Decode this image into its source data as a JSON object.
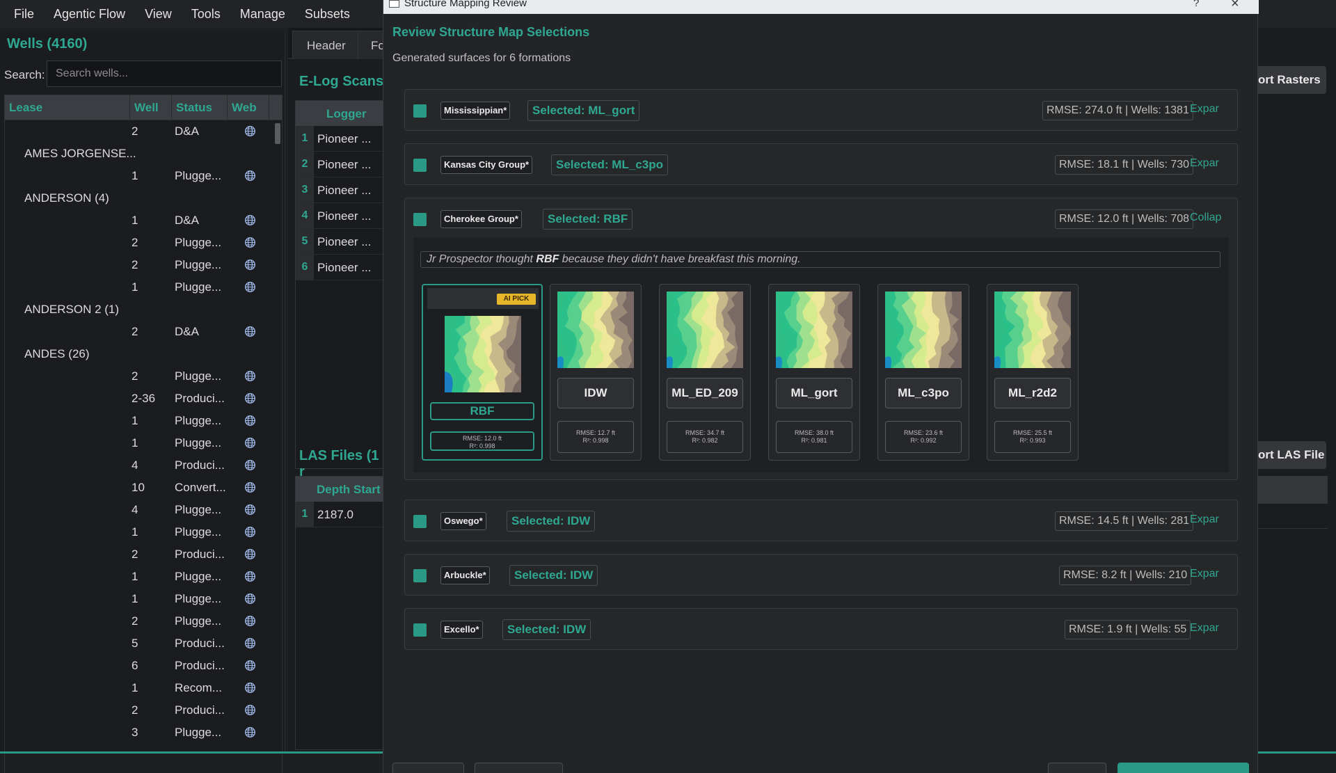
{
  "menu": [
    "File",
    "Agentic Flow",
    "View",
    "Tools",
    "Manage",
    "Subsets"
  ],
  "wells": {
    "title": "Wells (4160)",
    "search_label": "Search:",
    "search_placeholder": "Search wells...",
    "columns": [
      "Lease",
      "Well",
      "Status",
      "Web"
    ],
    "rows": [
      {
        "lease": "",
        "well": "2",
        "status": "D&A",
        "web": true
      },
      {
        "lease": "AMES JORGENSE...",
        "well": "",
        "status": "",
        "web": false
      },
      {
        "lease": "",
        "well": "1",
        "status": "Plugge...",
        "web": true
      },
      {
        "lease": "ANDERSON (4)",
        "well": "",
        "status": "",
        "web": false
      },
      {
        "lease": "",
        "well": "1",
        "status": "D&A",
        "web": true
      },
      {
        "lease": "",
        "well": "2",
        "status": "Plugge...",
        "web": true
      },
      {
        "lease": "",
        "well": "2",
        "status": "Plugge...",
        "web": true
      },
      {
        "lease": "",
        "well": "1",
        "status": "Plugge...",
        "web": true
      },
      {
        "lease": "ANDERSON 2 (1)",
        "well": "",
        "status": "",
        "web": false
      },
      {
        "lease": "",
        "well": "2",
        "status": "D&A",
        "web": true
      },
      {
        "lease": "ANDES (26)",
        "well": "",
        "status": "",
        "web": false
      },
      {
        "lease": "",
        "well": "2",
        "status": "Plugge...",
        "web": true
      },
      {
        "lease": "",
        "well": "2-36",
        "status": "Produci...",
        "web": true
      },
      {
        "lease": "",
        "well": "1",
        "status": "Plugge...",
        "web": true
      },
      {
        "lease": "",
        "well": "1",
        "status": "Plugge...",
        "web": true
      },
      {
        "lease": "",
        "well": "4",
        "status": "Produci...",
        "web": true
      },
      {
        "lease": "",
        "well": "10",
        "status": "Convert...",
        "web": true
      },
      {
        "lease": "",
        "well": "4",
        "status": "Plugge...",
        "web": true
      },
      {
        "lease": "",
        "well": "1",
        "status": "Plugge...",
        "web": true
      },
      {
        "lease": "",
        "well": "2",
        "status": "Produci...",
        "web": true
      },
      {
        "lease": "",
        "well": "1",
        "status": "Plugge...",
        "web": true
      },
      {
        "lease": "",
        "well": "1",
        "status": "Plugge...",
        "web": true
      },
      {
        "lease": "",
        "well": "2",
        "status": "Plugge...",
        "web": true
      },
      {
        "lease": "",
        "well": "5",
        "status": "Produci...",
        "web": true
      },
      {
        "lease": "",
        "well": "6",
        "status": "Produci...",
        "web": true
      },
      {
        "lease": "",
        "well": "1",
        "status": "Recom...",
        "web": true
      },
      {
        "lease": "",
        "well": "2",
        "status": "Produci...",
        "web": true
      },
      {
        "lease": "",
        "well": "3",
        "status": "Plugge...",
        "web": true
      }
    ]
  },
  "mid": {
    "tabs": [
      "Header",
      "Fo"
    ],
    "elog_title": "E-Log Scans",
    "elog_col": "Logger",
    "elog_rows": [
      "Pioneer ...",
      "Pioneer ...",
      "Pioneer ...",
      "Pioneer ...",
      "Pioneer ...",
      "Pioneer ..."
    ],
    "las_title": "LAS Files (1 r",
    "las_col": "Depth Start",
    "las_rows": [
      "2187.0"
    ]
  },
  "right": {
    "import_rasters": "ort Rasters",
    "import_las": "ort LAS File"
  },
  "dialog": {
    "window_title": "Structure Mapping Review",
    "help_glyph": "?",
    "close_glyph": "×",
    "heading": "Review Structure Map Selections",
    "subtitle": "Generated surfaces for 6 formations",
    "formations": [
      {
        "name": "Mississippian*",
        "selected": "Selected: ML_gort",
        "stats": "RMSE: 274.0 ft | Wells: 1381",
        "toggle": "Expar"
      },
      {
        "name": "Kansas City Group*",
        "selected": "Selected: ML_c3po",
        "stats": "RMSE: 18.1 ft | Wells: 730",
        "toggle": "Expar"
      },
      {
        "name": "Cherokee Group*",
        "selected": "Selected: RBF",
        "stats": "RMSE: 12.0 ft | Wells: 708",
        "toggle": "Collap"
      },
      {
        "name": "Oswego*",
        "selected": "Selected: IDW",
        "stats": "RMSE: 14.5 ft | Wells: 281",
        "toggle": "Expar"
      },
      {
        "name": "Arbuckle*",
        "selected": "Selected: IDW",
        "stats": "RMSE: 8.2 ft | Wells: 210",
        "toggle": "Expar"
      },
      {
        "name": "Excello*",
        "selected": "Selected: IDW",
        "stats": "RMSE: 1.9 ft | Wells: 55",
        "toggle": "Expar"
      }
    ],
    "rationale_prefix": "Jr Prospector thought ",
    "rationale_method": "RBF",
    "rationale_suffix": " because they didn't have breakfast this morning.",
    "ai_badge": "AI PICK",
    "methods": [
      {
        "name": "RBF",
        "rmse": "RMSE: 12.0 ft",
        "r2": "R²: 0.998",
        "ai": true
      },
      {
        "name": "IDW",
        "rmse": "RMSE: 12.7 ft",
        "r2": "R²: 0.998",
        "ai": false
      },
      {
        "name": "ML_ED_209",
        "rmse": "RMSE: 34.7 ft",
        "r2": "R²: 0.982",
        "ai": false
      },
      {
        "name": "ML_gort",
        "rmse": "RMSE: 38.0 ft",
        "r2": "R²: 0.981",
        "ai": false
      },
      {
        "name": "ML_c3po",
        "rmse": "RMSE: 23.6 ft",
        "r2": "R²: 0.992",
        "ai": false
      },
      {
        "name": "ML_r2d2",
        "rmse": "RMSE: 25.5 ft",
        "r2": "R²: 0.993",
        "ai": false
      }
    ]
  },
  "colors": {
    "accent": "#2fa892",
    "ai_badge": "#e8b62a",
    "background": "#1e1f22"
  }
}
